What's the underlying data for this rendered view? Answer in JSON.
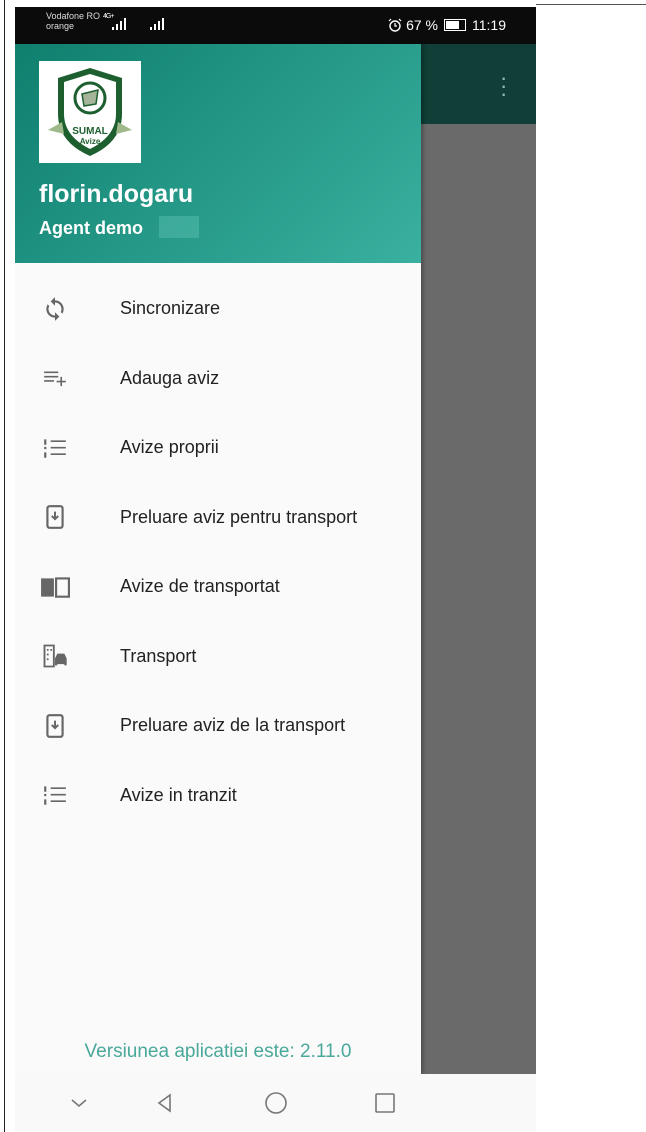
{
  "status_bar": {
    "carrier_top": "Vodafone RO",
    "carrier_bottom": "orange",
    "network": "4G+",
    "battery": "67 %",
    "time": "11:19"
  },
  "logo": {
    "line1": "SUMAL",
    "line2": "Avize"
  },
  "user": {
    "name": "florin.dogaru",
    "role": "Agent demo"
  },
  "menu": [
    {
      "label": "Sincronizare",
      "icon": "sync-icon"
    },
    {
      "label": "Adauga aviz",
      "icon": "playlist-add-icon"
    },
    {
      "label": "Avize proprii",
      "icon": "numbered-list-icon"
    },
    {
      "label": "Preluare aviz pentru transport",
      "icon": "phone-download-icon"
    },
    {
      "label": "Avize de transportat",
      "icon": "book-icon"
    },
    {
      "label": "Transport",
      "icon": "building-car-icon"
    },
    {
      "label": "Preluare aviz de la transport",
      "icon": "phone-download-icon"
    },
    {
      "label": "Avize in tranzit",
      "icon": "numbered-list-icon"
    }
  ],
  "version_text": "Versiunea aplicatiei este: 2.11.0",
  "colors": {
    "header_start": "#0f7f6e",
    "header_end": "#3ab0a0",
    "accent_text": "#4aa89a",
    "appbar": "#0f3f36"
  }
}
